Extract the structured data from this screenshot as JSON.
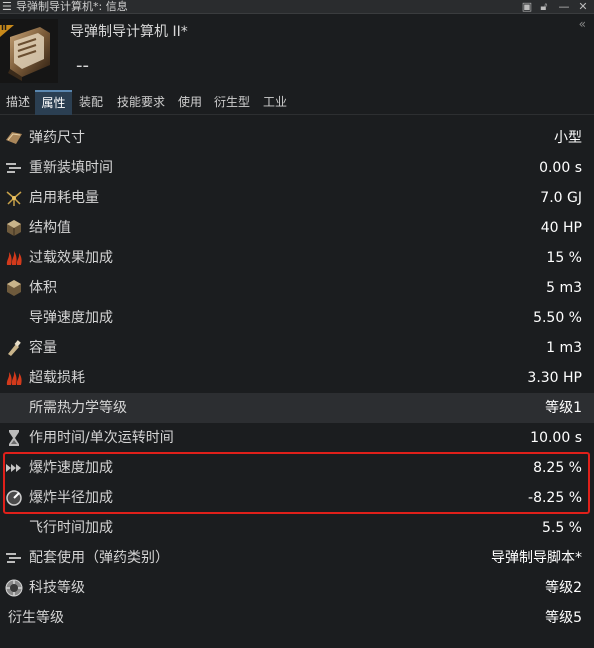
{
  "window": {
    "title": "导弹制导计算机*: 信息"
  },
  "header": {
    "item_name": "导弹制导计算机 II*",
    "item_subtitle": "--",
    "tech_badge": "II",
    "collapse_icon": "double-chevron-left-icon"
  },
  "tabs": [
    {
      "label": "描述"
    },
    {
      "label": "属性"
    },
    {
      "label": "装配"
    },
    {
      "label": "技能要求"
    },
    {
      "label": "使用"
    },
    {
      "label": "衍生型"
    },
    {
      "label": "工业"
    }
  ],
  "active_tab": "属性",
  "attributes": [
    {
      "label": "弹药尺寸",
      "value": "小型",
      "icon": "charge-size-icon"
    },
    {
      "label": "重新装填时间",
      "value": "0.00 s",
      "icon": "reload-time-icon"
    },
    {
      "label": "启用耗电量",
      "value": "7.0 GJ",
      "icon": "capacitor-need-icon"
    },
    {
      "label": "结构值",
      "value": "40 HP",
      "icon": "structure-hp-icon"
    },
    {
      "label": "过载效果加成",
      "value": "15 %",
      "icon": "overload-bonus-icon"
    },
    {
      "label": "体积",
      "value": "5 m3",
      "icon": "volume-icon"
    },
    {
      "label": "导弹速度加成",
      "value": "5.50 %",
      "icon": ""
    },
    {
      "label": "容量",
      "value": "1 m3",
      "icon": "capacity-icon"
    },
    {
      "label": "超载损耗",
      "value": "3.30 HP",
      "icon": "heat-damage-icon"
    },
    {
      "label": "所需热力学等级",
      "value": "等级1",
      "icon": ""
    },
    {
      "label": "作用时间/单次运转时间",
      "value": "10.00 s",
      "icon": "hourglass-icon"
    },
    {
      "label": "爆炸速度加成",
      "value": "8.25 %",
      "icon": "explosion-velocity-icon"
    },
    {
      "label": "爆炸半径加成",
      "value": "-8.25 %",
      "icon": "explosion-radius-icon"
    },
    {
      "label": "飞行时间加成",
      "value": "5.5 %",
      "icon": ""
    },
    {
      "label": "配套使用（弹药类别）",
      "value": "导弹制导脚本*",
      "icon": "used-with-icon"
    },
    {
      "label": "科技等级",
      "value": "等级2",
      "icon": "tech-level-icon"
    },
    {
      "label": "衍生等级",
      "value": "等级5",
      "icon": ""
    }
  ],
  "highlighted_rows": [
    "爆炸速度加成",
    "爆炸半径加成"
  ],
  "colors": {
    "background": "#1b1d1f",
    "active_tab": "#2b3f52",
    "highlight_box": "#e0201a",
    "tech_badge": "#c98a1a"
  }
}
